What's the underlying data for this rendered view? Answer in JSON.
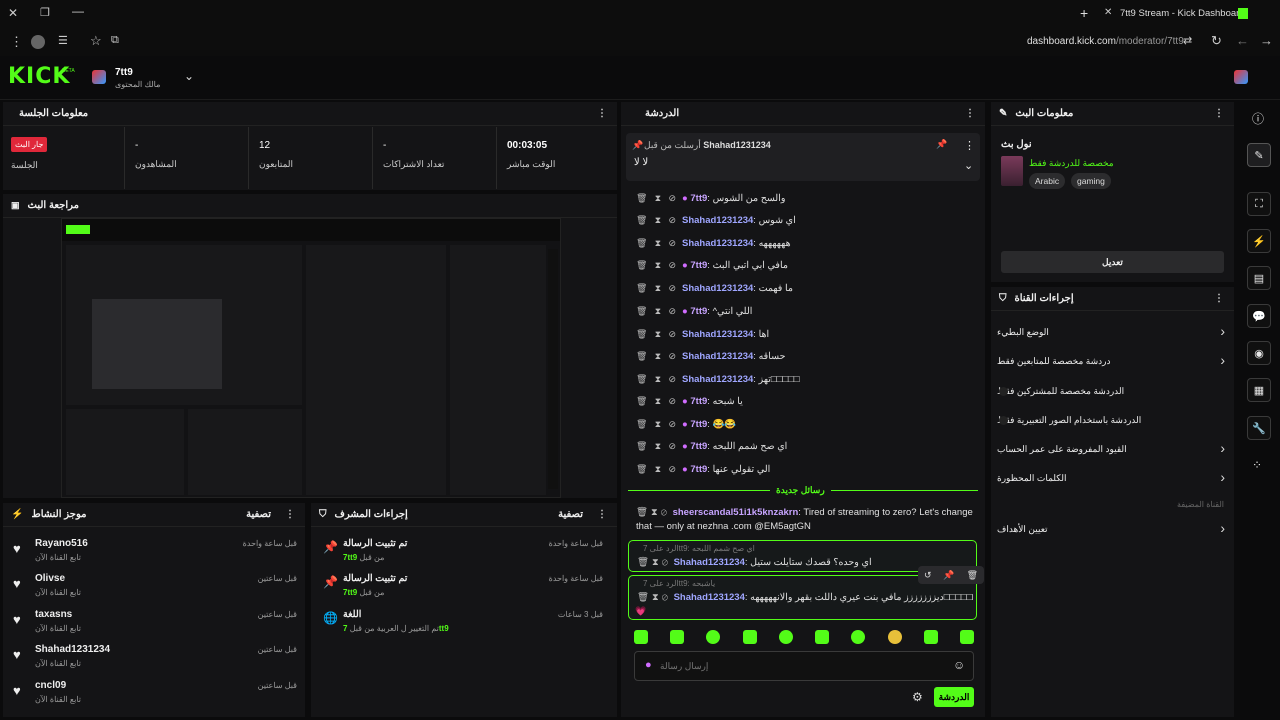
{
  "browser": {
    "tab_title": "7tt9 Stream - Kick Dashboard",
    "url_host": "dashboard.kick.com",
    "url_path": "/moderator/7tt9"
  },
  "app": {
    "logo": "KICK",
    "logo_badge": "BETA",
    "channel_name": "7tt9",
    "channel_role": "مالك المحتوى",
    "accent": "#53fc18"
  },
  "session": {
    "title": "معلومات الجلسة",
    "stats": [
      {
        "value": "00:03:05",
        "label": "الوقت مباشر"
      },
      {
        "value": "-",
        "label": "تعداد الاشتراكات"
      },
      {
        "value": "12",
        "label": "المتابعون"
      },
      {
        "value": "-",
        "label": "المشاهدون"
      },
      {
        "value": "جار البث",
        "label": "الجلسة"
      }
    ]
  },
  "preview": {
    "title": "مراجعة البث"
  },
  "chat": {
    "title": "الدردشة",
    "pinned": {
      "by": "Shahad1231234",
      "by_prefix": "أرسلت من قبل",
      "text": "لا لا"
    },
    "messages": [
      {
        "user": "7tt9",
        "text": "والسح من الشوس"
      },
      {
        "user": "Shahad1231234",
        "text": "اي شوس"
      },
      {
        "user": "Shahad1231234",
        "text": "ههههههه"
      },
      {
        "user": "7tt9",
        "text": "مافي ابي اتبي البث"
      },
      {
        "user": "Shahad1231234",
        "text": "ما فهمت"
      },
      {
        "user": "7tt9",
        "text": "^اللي انتي"
      },
      {
        "user": "Shahad1231234",
        "text": "اها"
      },
      {
        "user": "Shahad1231234",
        "text": "حساقه"
      },
      {
        "user": "Shahad1231234",
        "text": "تهز□□□□□"
      },
      {
        "user": "7tt9",
        "text": "يا شبحه"
      },
      {
        "user": "7tt9",
        "text": "😂😂"
      },
      {
        "user": "7tt9",
        "text": "اي صح شمم اللبحه"
      },
      {
        "user": "7tt9",
        "text": "الي تقولي عنها"
      }
    ],
    "new_messages": "رسائل جديدة",
    "spam": {
      "user": "sheerscandal51i1k5knzakrn",
      "text": "Tired of streaming to zero? Let's change that — only at nezhna .com @EM5agtGN"
    },
    "reply1": {
      "context": "الرد على 7tt9: اي صح شمم اللبحه",
      "user": "Shahad1231234",
      "text": "اي وحده؟ قصدك ستايلت ستيل"
    },
    "reply2": {
      "context": "الرد على 7tt9: ياشبحه",
      "user": "Shahad1231234",
      "text": "ديززززززز مافي بنت عيري داللت بقهر والانهههههه□□□□□□□□□",
      "heart": "💗"
    },
    "input_placeholder": "إرسال رسالة",
    "send_label": "الدردشة",
    "emotes": [
      "🟩",
      "🟩",
      "🟩",
      "🟩",
      "🟩",
      "🟩",
      "🟩",
      "🟩",
      "🟩",
      "🟩"
    ]
  },
  "stream_info": {
    "title": "معلومات البث",
    "stream_title": "نول بث",
    "category": "مخصصة للدردشة فقط",
    "tags": [
      "Arabic",
      "gaming"
    ],
    "edit_label": "تعديل"
  },
  "channel_actions": {
    "title": "إجراءات القناة",
    "items": [
      {
        "label": "الوضع البطيء",
        "control": "chevron"
      },
      {
        "label": "دردشة مخصصة للمتابعين فقط",
        "control": "chevron"
      },
      {
        "label": "الدردشة مخصصة للمشتركين فقط",
        "control": "toggle"
      },
      {
        "label": "الدردشة باستخدام الصور التعبيرية فقط",
        "control": "toggle"
      },
      {
        "label": "القيود المفروضة على عمر الحساب",
        "control": "chevron"
      },
      {
        "label": "الكلمات المحظورة",
        "control": "chevron"
      }
    ],
    "section_label": "القناة المضيفة",
    "goals_label": "تعيين الأهداف"
  },
  "activity": {
    "title": "موجز النشاط",
    "filter": "تصفية",
    "items": [
      {
        "name": "Rayano516",
        "sub": "تابع القناة الآن",
        "time": "قبل ساعة واحدة"
      },
      {
        "name": "Olivse",
        "sub": "تابع القناة الآن",
        "time": "قبل ساعتين"
      },
      {
        "name": "taxasns",
        "sub": "تابع القناة الآن",
        "time": "قبل ساعتين"
      },
      {
        "name": "Shahad1231234",
        "sub": "تابع القناة الآن",
        "time": "قبل ساعتين"
      },
      {
        "name": "cncl09",
        "sub": "تابع القناة الآن",
        "time": "قبل ساعتين"
      }
    ]
  },
  "mod_actions": {
    "title": "إجراءات المشرف",
    "filter": "تصفية",
    "items": [
      {
        "title": "تم تثبيت الرسالة",
        "by": "7tt9",
        "by_suffix": "من قبل",
        "time": "قبل ساعة واحدة"
      },
      {
        "title": "تم تثبيت الرسالة",
        "by": "7tt9",
        "by_suffix": "من قبل",
        "time": "قبل ساعة واحدة"
      },
      {
        "title": "اللغة",
        "by": "7tt9",
        "detail": "تم التغيير ل العربية من قبل",
        "time": "قبل 3 ساعات"
      }
    ]
  }
}
